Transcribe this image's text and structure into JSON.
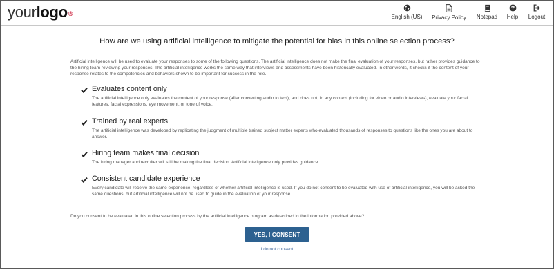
{
  "header": {
    "logo_main": "your",
    "logo_bold": "logo",
    "logo_mark": "®",
    "nav": [
      {
        "label": "English (US)",
        "icon": "globe-icon"
      },
      {
        "label": "Privacy Policy",
        "icon": "document-icon"
      },
      {
        "label": "Notepad",
        "icon": "notebook-icon"
      },
      {
        "label": "Help",
        "icon": "help-icon"
      },
      {
        "label": "Logout",
        "icon": "logout-icon"
      }
    ]
  },
  "main": {
    "title": "How are we using artificial intelligence to mitigate the potential for bias in this online selection process?",
    "intro": "Artificial intelligence will be used to evaluate your responses to some of the following questions. The artificial intelligence does not make the final evaluation of your responses, but rather provides guidance to the hiring team reviewing your responses. The artificial intelligence works the same way that interviews and assessments have been historically evaluated. In other words, it checks if the content of your response relates to the competencies and behaviors shown to be important for success in the role.",
    "items": [
      {
        "title": "Evaluates content only",
        "desc": "The artificial intelligence only evaluates the content of your response (after converting audio to text), and does not, in any context (including for video or audio interviews), evaluate your facial features, facial expressions, eye movement, or tone of voice."
      },
      {
        "title": "Trained by real experts",
        "desc": "The artificial intelligence was developed by replicating the judgment of multiple trained subject matter experts who evaluated thousands of responses to questions like the ones you are about to answer."
      },
      {
        "title": "Hiring team makes final decision",
        "desc": "The hiring manager and recruiter will still be making the final decision. Artificial intelligence only provides guidance."
      },
      {
        "title": "Consistent candidate experience",
        "desc": "Every candidate will receive the same experience, regardless of whether artificial intelligence is used. If you do not consent to be evaluated with use of artificial intelligence, you will be asked the same questions, but artificial intelligence will not be used to guide in the evaluation of your response."
      }
    ],
    "question": "Do you consent to be evaluated in this online selection process by the artificial intelligence program as described in the information provided above?",
    "consent_button": "YES, I CONSENT",
    "decline_link": "I do not consent"
  },
  "colors": {
    "accent": "#2d6190",
    "logo_mark": "#c8102e",
    "link": "#4a6fa0"
  }
}
